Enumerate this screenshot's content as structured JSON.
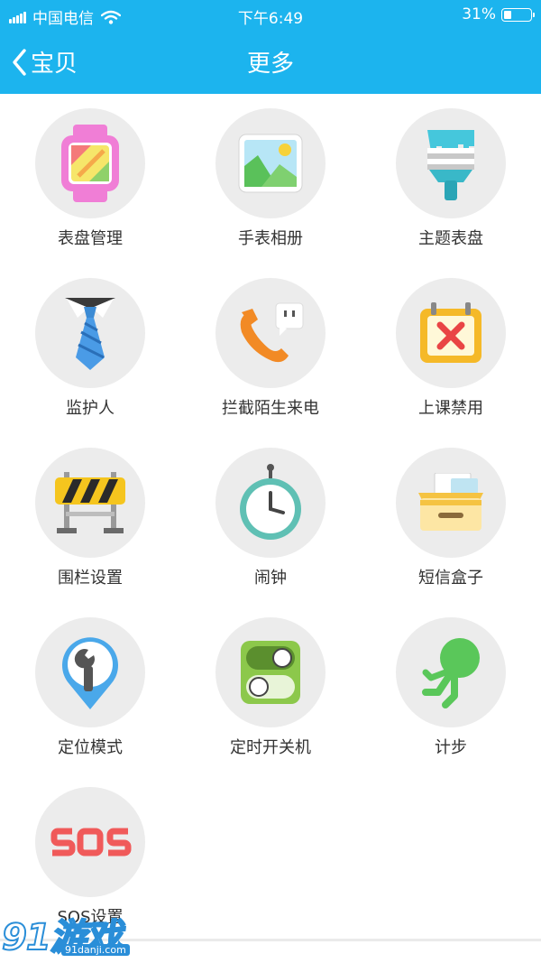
{
  "status_bar": {
    "carrier": "中国电信",
    "time": "下午6:49",
    "battery_text": "31%",
    "battery_level": 0.31
  },
  "nav": {
    "back_label": "宝贝",
    "title": "更多"
  },
  "items": [
    {
      "label": "表盘管理",
      "icon": "watch-face-icon"
    },
    {
      "label": "手表相册",
      "icon": "photo-album-icon"
    },
    {
      "label": "主题表盘",
      "icon": "paint-brush-icon"
    },
    {
      "label": "监护人",
      "icon": "necktie-icon"
    },
    {
      "label": "拦截陌生来电",
      "icon": "phone-block-icon"
    },
    {
      "label": "上课禁用",
      "icon": "calendar-x-icon"
    },
    {
      "label": "围栏设置",
      "icon": "barrier-icon"
    },
    {
      "label": "闹钟",
      "icon": "stopwatch-icon"
    },
    {
      "label": "短信盒子",
      "icon": "message-box-icon"
    },
    {
      "label": "定位模式",
      "icon": "location-wrench-icon"
    },
    {
      "label": "定时开关机",
      "icon": "toggle-switch-icon"
    },
    {
      "label": "计步",
      "icon": "runner-icon"
    },
    {
      "label": "SOS设置",
      "icon": "sos-icon"
    }
  ],
  "watermark": {
    "big": "91游戏",
    "small": "91danji.com"
  },
  "colors": {
    "header": "#1cb4ee",
    "icon_bg": "#ececec"
  }
}
